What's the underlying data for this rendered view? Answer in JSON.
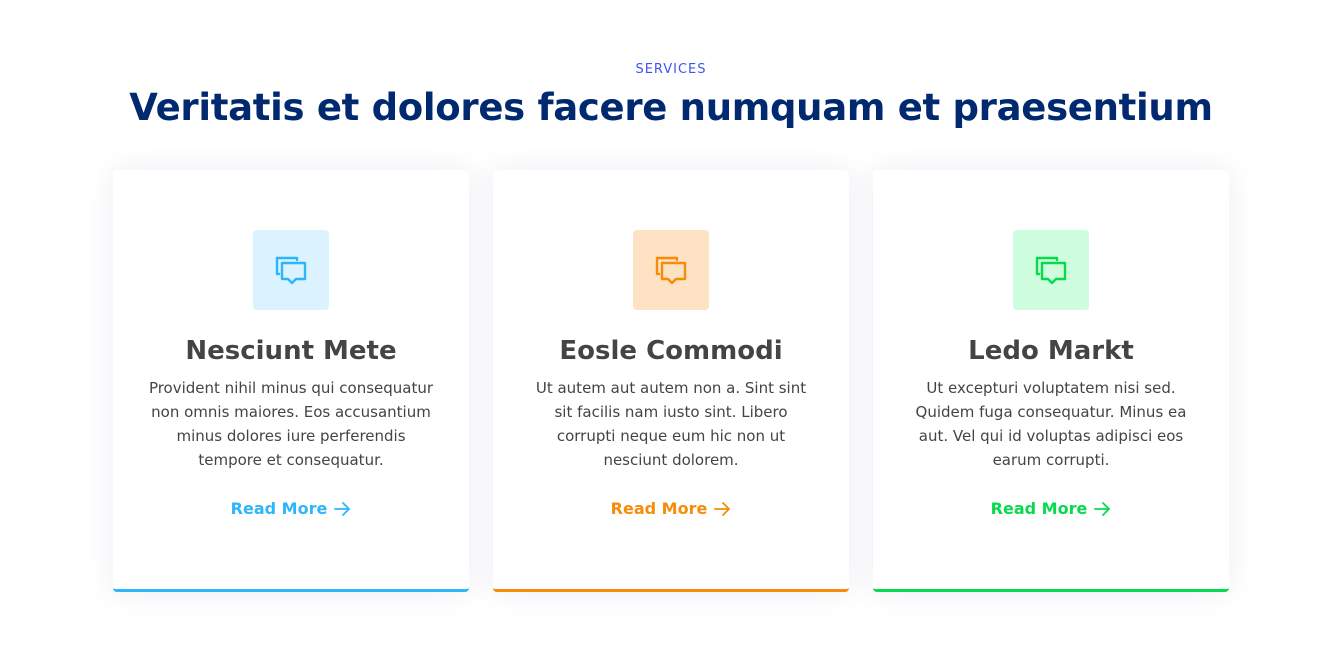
{
  "section": {
    "eyebrow": "SERVICES",
    "headline": "Veritatis et dolores facere numquam et praesentium"
  },
  "cards": [
    {
      "title": "Nesciunt Mete",
      "text": "Provident nihil minus qui consequatur non omnis maiores. Eos accusantium minus dolores iure perferendis tempore et consequatur.",
      "link": "Read More",
      "icon": "chat-icon",
      "accent": "#2db6fa"
    },
    {
      "title": "Eosle Commodi",
      "text": "Ut autem aut autem non a. Sint sint sit facilis nam iusto sint. Libero corrupti neque eum hic non ut nesciunt dolorem.",
      "link": "Read More",
      "icon": "chat-icon",
      "accent": "#f68c09"
    },
    {
      "title": "Ledo Markt",
      "text": "Ut excepturi voluptatem nisi sed. Quidem fuga consequatur. Minus ea aut. Vel qui id voluptas adipisci eos earum corrupti.",
      "link": "Read More",
      "icon": "chat-icon",
      "accent": "#08da4e"
    }
  ],
  "colors": {
    "eyebrow": "#4154f1",
    "headline": "#012970",
    "body_text": "#444444"
  }
}
